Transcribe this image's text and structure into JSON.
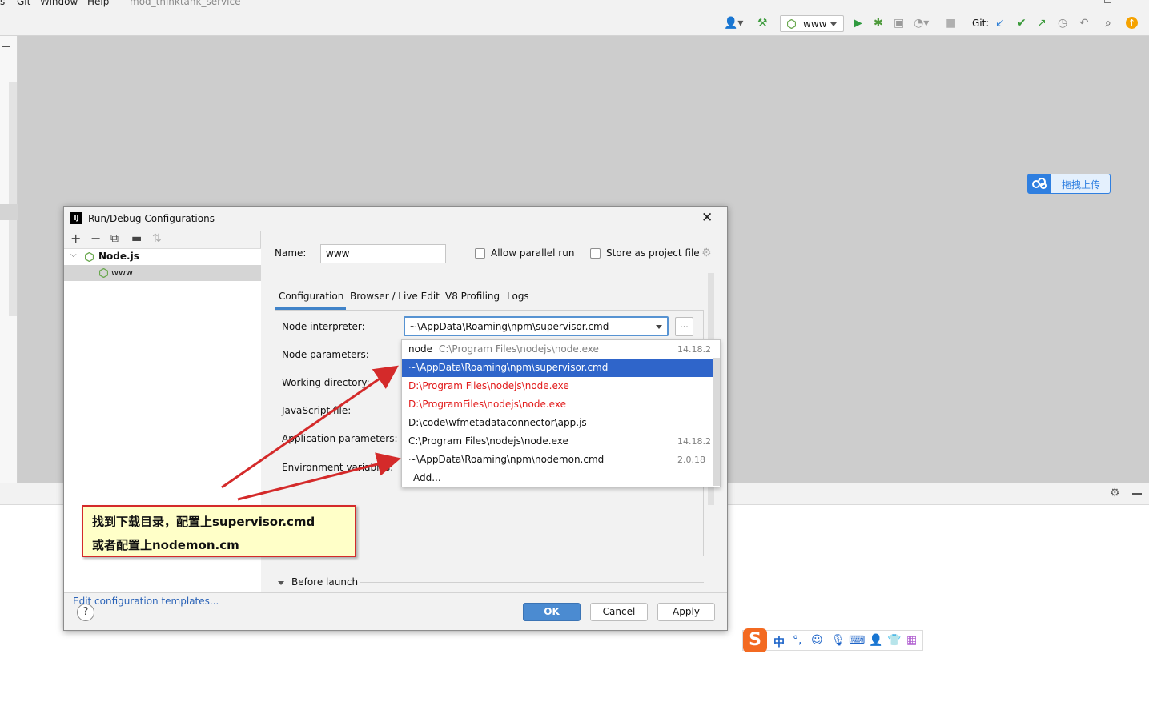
{
  "menubar": {
    "items": [
      "s",
      "Git",
      "Window",
      "Help"
    ],
    "project": "mod_thinktank_service"
  },
  "toolbar": {
    "run_config_label": "www",
    "git_label": "Git:"
  },
  "upload_button": {
    "label": "拖拽上传"
  },
  "dialog": {
    "title": "Run/Debug Configurations",
    "logo_text": "IJ",
    "close_glyph": "✕",
    "tree": {
      "group": "Node.js",
      "items": [
        "www"
      ]
    },
    "edit_templates_link": "Edit configuration templates...",
    "name_label": "Name:",
    "name_value": "www",
    "allow_parallel_label": "Allow parallel run",
    "store_project_label": "Store as project file",
    "tabs": [
      "Configuration",
      "Browser / Live Edit",
      "V8 Profiling",
      "Logs"
    ],
    "fields": {
      "node_interpreter": "Node interpreter:",
      "node_parameters": "Node parameters:",
      "working_directory": "Working directory:",
      "javascript_file": "JavaScript file:",
      "application_parameters": "Application parameters:",
      "environment_variables": "Environment variables:"
    },
    "interpreter_value": "~\\AppData\\Roaming\\npm\\supervisor.cmd",
    "browse_label": "...",
    "before_launch": "Before launch",
    "help_label": "?",
    "ok_label": "OK",
    "cancel_label": "Cancel",
    "apply_label": "Apply"
  },
  "dropdown": {
    "options": [
      {
        "alias": "node",
        "path": "C:\\Program Files\\nodejs\\node.exe",
        "version": "14.18.2",
        "style": "normal"
      },
      {
        "alias": "",
        "path": "~\\AppData\\Roaming\\npm\\supervisor.cmd",
        "version": "",
        "style": "selected"
      },
      {
        "alias": "",
        "path": "D:\\Program Files\\nodejs\\node.exe",
        "version": "",
        "style": "invalid"
      },
      {
        "alias": "",
        "path": "D:\\ProgramFiles\\nodejs\\node.exe",
        "version": "",
        "style": "invalid"
      },
      {
        "alias": "",
        "path": "D:\\code\\wfmetadataconnector\\app.js",
        "version": "",
        "style": "normal"
      },
      {
        "alias": "",
        "path": "C:\\Program Files\\nodejs\\node.exe",
        "version": "14.18.2",
        "style": "normal"
      },
      {
        "alias": "",
        "path": "~\\AppData\\Roaming\\npm\\nodemon.cmd",
        "version": "2.0.18",
        "style": "normal"
      },
      {
        "alias": "",
        "path": "Add...",
        "version": "",
        "style": "add"
      }
    ]
  },
  "annotation": {
    "line1": "找到下载目录，配置上supervisor.cmd",
    "line2": "或者配置上nodemon.cm"
  },
  "ime": {
    "logo": "S",
    "mode": "中",
    "punct": "°,"
  },
  "colors": {
    "accent": "#2f65ca",
    "invalid": "#e21b1b",
    "annotation_border": "#d42a2a",
    "annotation_fill": "#ffffc8"
  }
}
